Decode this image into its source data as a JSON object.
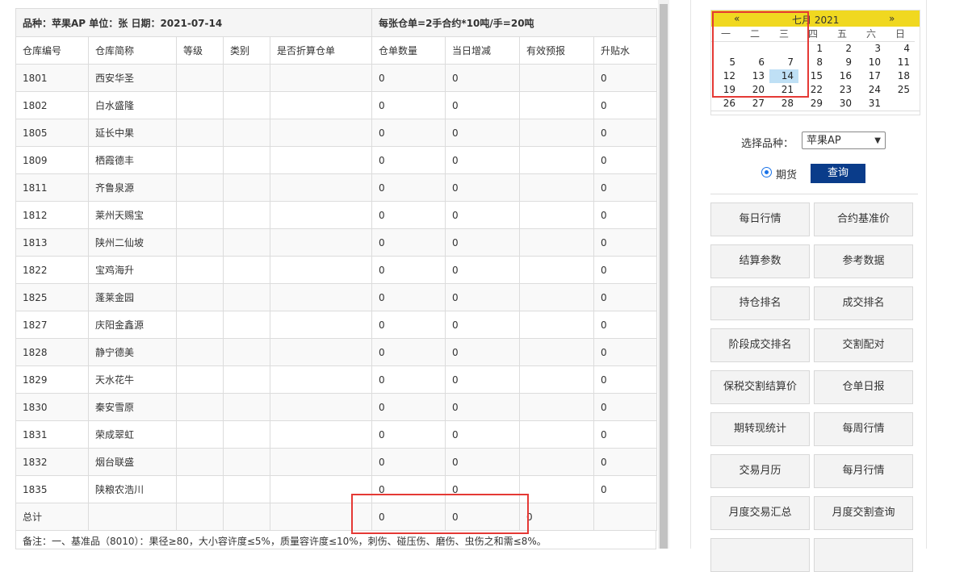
{
  "info": {
    "left": "品种：苹果AP    单位：张    日期：2021-07-14",
    "right": "每张仓单=2手合约*10吨/手=20吨"
  },
  "columns": [
    "仓库编号",
    "仓库简称",
    "等级",
    "类别",
    "是否折算仓单",
    "仓单数量",
    "当日增减",
    "有效预报",
    "升贴水"
  ],
  "rows": [
    [
      "1801",
      "西安华圣",
      "",
      "",
      "",
      "0",
      "0",
      "",
      "0"
    ],
    [
      "1802",
      "白水盛隆",
      "",
      "",
      "",
      "0",
      "0",
      "",
      "0"
    ],
    [
      "1805",
      "延长中果",
      "",
      "",
      "",
      "0",
      "0",
      "",
      "0"
    ],
    [
      "1809",
      "栖霞德丰",
      "",
      "",
      "",
      "0",
      "0",
      "",
      "0"
    ],
    [
      "1811",
      "齐鲁泉源",
      "",
      "",
      "",
      "0",
      "0",
      "",
      "0"
    ],
    [
      "1812",
      "莱州天赐宝",
      "",
      "",
      "",
      "0",
      "0",
      "",
      "0"
    ],
    [
      "1813",
      "陕州二仙坡",
      "",
      "",
      "",
      "0",
      "0",
      "",
      "0"
    ],
    [
      "1822",
      "宝鸡海升",
      "",
      "",
      "",
      "0",
      "0",
      "",
      "0"
    ],
    [
      "1825",
      "蓬莱金园",
      "",
      "",
      "",
      "0",
      "0",
      "",
      "0"
    ],
    [
      "1827",
      "庆阳金鑫源",
      "",
      "",
      "",
      "0",
      "0",
      "",
      "0"
    ],
    [
      "1828",
      "静宁德美",
      "",
      "",
      "",
      "0",
      "0",
      "",
      "0"
    ],
    [
      "1829",
      "天水花牛",
      "",
      "",
      "",
      "0",
      "0",
      "",
      "0"
    ],
    [
      "1830",
      "秦安雪原",
      "",
      "",
      "",
      "0",
      "0",
      "",
      "0"
    ],
    [
      "1831",
      "荣成翠虹",
      "",
      "",
      "",
      "0",
      "0",
      "",
      "0"
    ],
    [
      "1832",
      "烟台联盛",
      "",
      "",
      "",
      "0",
      "0",
      "",
      "0"
    ],
    [
      "1835",
      "陕粮农浩川",
      "",
      "",
      "",
      "0",
      "0",
      "",
      "0"
    ]
  ],
  "total": [
    "总计",
    "",
    "",
    "",
    "",
    "0",
    "0",
    "0",
    ""
  ],
  "note": "备注：一、基准品（8010）：果径≥80，大小容许度≤5%，质量容许度≤10%，刺伤、碰压伤、磨伤、虫伤之和需≤8%。",
  "calendar": {
    "prev": "«",
    "title": "七月 2021",
    "next": "»",
    "weekdays": [
      "一",
      "二",
      "三",
      "四",
      "五",
      "六",
      "日"
    ],
    "weeks": [
      [
        "",
        "",
        "",
        "1",
        "2",
        "3",
        "4"
      ],
      [
        "5",
        "6",
        "7",
        "8",
        "9",
        "10",
        "11"
      ],
      [
        "12",
        "13",
        "14",
        "15",
        "16",
        "17",
        "18"
      ],
      [
        "19",
        "20",
        "21",
        "22",
        "23",
        "24",
        "25"
      ],
      [
        "26",
        "27",
        "28",
        "29",
        "30",
        "31",
        ""
      ]
    ],
    "selected": "14"
  },
  "form": {
    "choose_label": "选择品种：",
    "selected_variety": "苹果AP",
    "radio_label": "期货",
    "query_button": "查询"
  },
  "nav": [
    "每日行情",
    "合约基准价",
    "结算参数",
    "参考数据",
    "持仓排名",
    "成交排名",
    "阶段成交排名",
    "交割配对",
    "保税交割结算价",
    "仓单日报",
    "期转现统计",
    "每周行情",
    "交易月历",
    "每月行情",
    "月度交易汇总",
    "月度交割查询"
  ],
  "colors": {
    "calendar_bar": "#f0d820",
    "query_button": "#0a3c8a",
    "highlight": "#e53935",
    "selected_day": "#bfe0f5"
  }
}
